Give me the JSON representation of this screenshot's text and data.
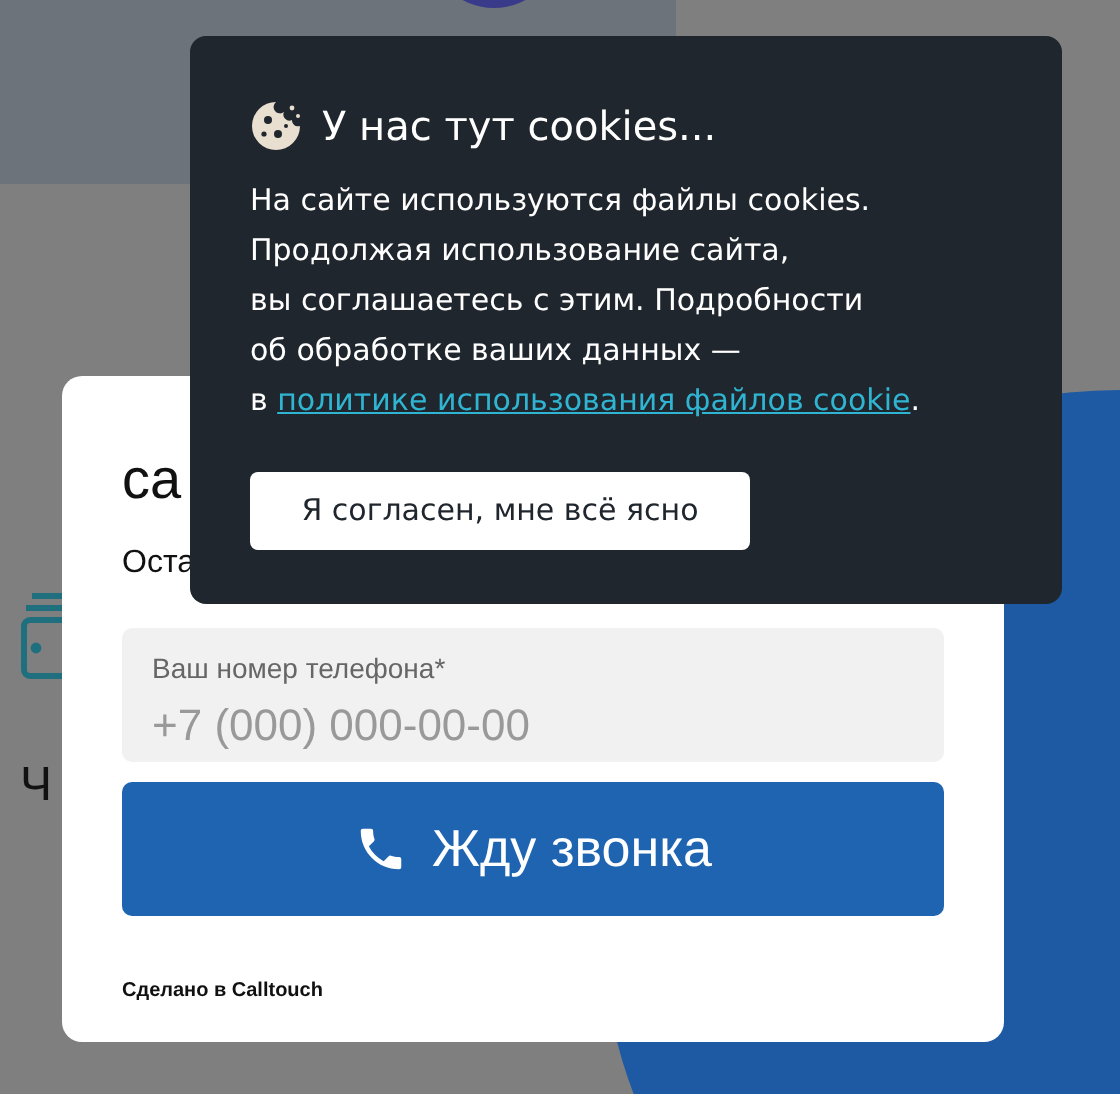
{
  "background": {
    "heading": "Ч"
  },
  "callback_form": {
    "title": "ca",
    "subtitle": "Оста",
    "phone_field": {
      "label": "Ваш номер телефона*",
      "placeholder": "+7 (000) 000-00-00"
    },
    "submit_button": "Жду звонка",
    "footer": "Сделано в Calltouch"
  },
  "cookie_banner": {
    "title": "У нас тут cookies...",
    "text_lines": [
      "На сайте используются файлы cookies.",
      "Продолжая использование сайта,",
      "вы соглашаетесь с этим. Подробности",
      "об обработке ваших данных —"
    ],
    "link_prefix": "в",
    "link": "политике использования файлов cookie",
    "link_suffix": ".",
    "accept_button": "Я согласен, мне всё ясно"
  }
}
